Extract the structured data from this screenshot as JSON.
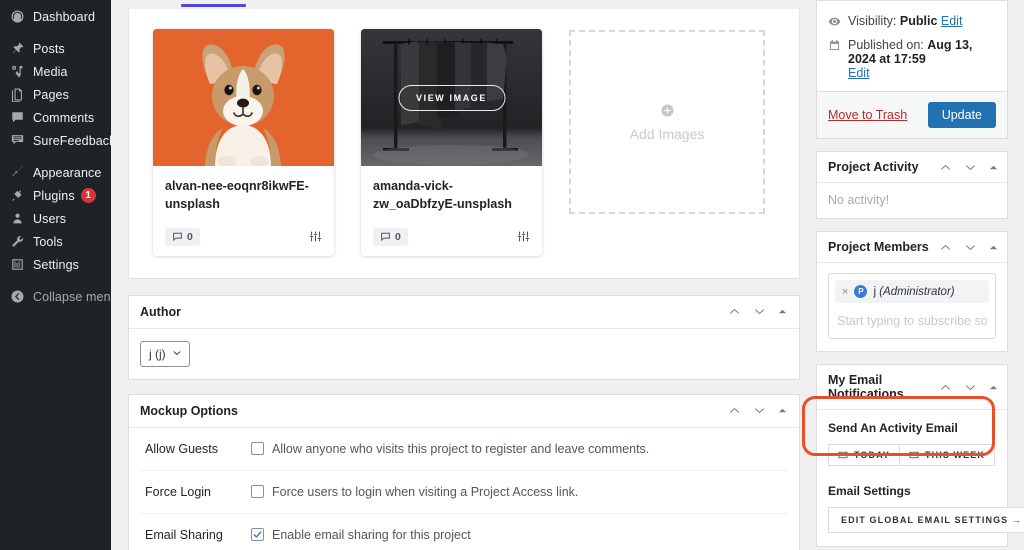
{
  "sidebar": {
    "items": [
      {
        "label": "Dashboard",
        "icon": "dashboard-icon",
        "name": "dashboard"
      },
      {
        "label": "Posts",
        "icon": "pin-icon",
        "name": "posts"
      },
      {
        "label": "Media",
        "icon": "media-icon",
        "name": "media"
      },
      {
        "label": "Pages",
        "icon": "pages-icon",
        "name": "pages"
      },
      {
        "label": "Comments",
        "icon": "comment-icon",
        "name": "comments"
      },
      {
        "label": "SureFeedback",
        "icon": "feedback-icon",
        "name": "surefeedback"
      },
      {
        "label": "Appearance",
        "icon": "brush-icon",
        "name": "appearance"
      },
      {
        "label": "Plugins",
        "icon": "plug-icon",
        "name": "plugins",
        "badge": "1"
      },
      {
        "label": "Users",
        "icon": "user-icon",
        "name": "users"
      },
      {
        "label": "Tools",
        "icon": "wrench-icon",
        "name": "tools"
      },
      {
        "label": "Settings",
        "icon": "settings-icon",
        "name": "settings"
      },
      {
        "label": "Collapse menu",
        "icon": "collapse-icon",
        "name": "collapse-menu"
      }
    ]
  },
  "images": {
    "cards": [
      {
        "title": "alvan-nee-eoqnr8ikwFE-unsplash",
        "comment_count": "0",
        "overlay_label": ""
      },
      {
        "title": "amanda-vick-zw_oaDbfzyE-unsplash",
        "comment_count": "0",
        "overlay_label": "VIEW IMAGE"
      }
    ],
    "add_images_label": "Add Images"
  },
  "author_panel": {
    "title": "Author",
    "selected": "j (j)"
  },
  "mockup_options": {
    "title": "Mockup Options",
    "rows": [
      {
        "label": "Allow Guests",
        "text": "Allow anyone who visits this project to register and leave comments.",
        "checked": false
      },
      {
        "label": "Force Login",
        "text": "Force users to login when visiting a Project Access link.",
        "checked": false
      },
      {
        "label": "Email Sharing",
        "text": "Enable email sharing for this project",
        "checked": true
      }
    ]
  },
  "publish": {
    "visibility_label": "Visibility:",
    "visibility_value": "Public",
    "visibility_edit": "Edit",
    "published_label": "Published on:",
    "published_value": "Aug 13, 2024 at 17:59",
    "published_edit": "Edit",
    "trash_label": "Move to Trash",
    "update_label": "Update"
  },
  "project_activity": {
    "title": "Project Activity",
    "empty_text": "No activity!"
  },
  "project_members": {
    "title": "Project Members",
    "member": {
      "remove": "×",
      "avatar_letter": "P",
      "name": "j",
      "role": "(Administrator)"
    },
    "input_placeholder": "Start typing to subscribe someone..."
  },
  "email_notifications": {
    "title": "My Email Notifications",
    "activity_heading": "Send An Activity Email",
    "today_label": "TODAY",
    "this_week_label": "THIS WEEK",
    "settings_heading": "Email Settings",
    "edit_global_label": "EDIT GLOBAL EMAIL SETTINGS  →"
  },
  "colors": {
    "highlight": "#e8502a",
    "accent_tab": "#4f46e5",
    "primary_button": "#2271b1",
    "badge": "#d63638",
    "sidebar_bg": "#1d2327"
  }
}
